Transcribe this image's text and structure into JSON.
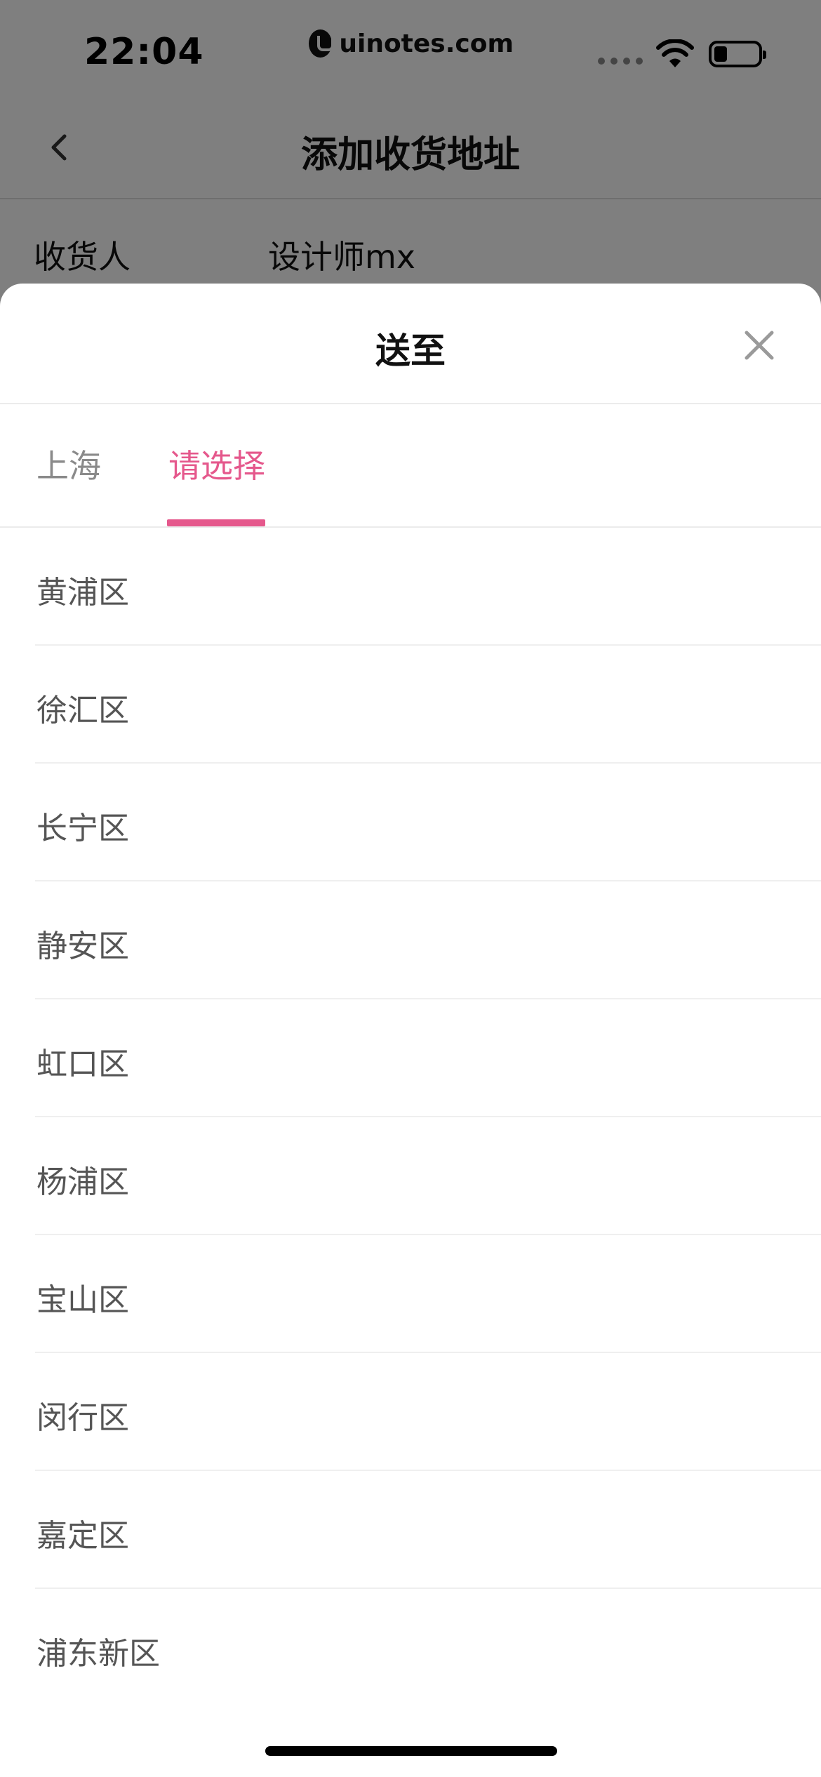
{
  "status_bar": {
    "time": "22:04",
    "url": "uinotes.com",
    "icons": [
      "cellular-signal-icon",
      "wifi-icon",
      "battery-icon"
    ]
  },
  "nav": {
    "title": "添加收货地址",
    "back_icon": "chevron-left-icon"
  },
  "form": {
    "recipient_label": "收货人",
    "recipient_value": "设计师mx"
  },
  "sheet": {
    "title": "送至",
    "close_icon": "close-icon",
    "tabs": [
      {
        "label": "上海",
        "active": false
      },
      {
        "label": "请选择",
        "active": true
      }
    ],
    "districts": [
      {
        "label": "黄浦区"
      },
      {
        "label": "徐汇区"
      },
      {
        "label": "长宁区"
      },
      {
        "label": "静安区"
      },
      {
        "label": "虹口区"
      },
      {
        "label": "杨浦区"
      },
      {
        "label": "宝山区"
      },
      {
        "label": "闵行区"
      },
      {
        "label": "嘉定区"
      },
      {
        "label": "浦东新区"
      }
    ]
  },
  "colors": {
    "accent": "#e5588c",
    "overlay": "rgba(0,0,0,0.5)",
    "list_text": "#555555",
    "inactive_tab": "#8a8a8a"
  }
}
